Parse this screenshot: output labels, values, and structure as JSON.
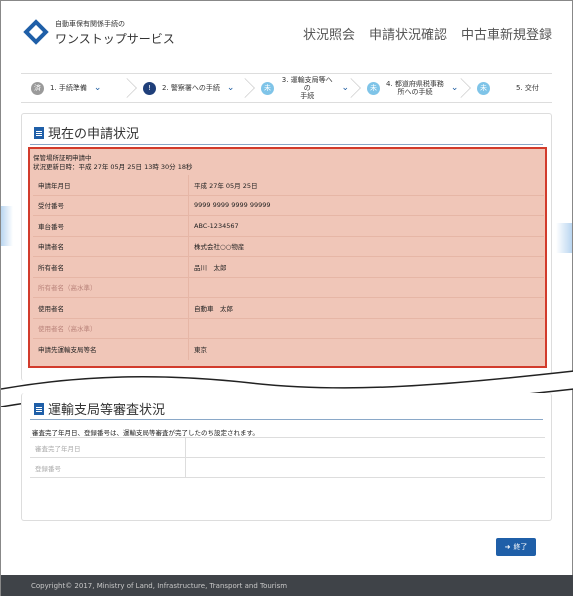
{
  "header": {
    "brand_sub": "自動車保有関係手続の",
    "brand_main": "ワンストップサービス",
    "nav": [
      "状況照会",
      "申請状況確認",
      "中古車新規登録"
    ]
  },
  "steps": [
    {
      "label": "1. 手続準備",
      "badge": "済",
      "color": "#9a9a9a"
    },
    {
      "label": "2. 警察署への手続",
      "badge": "!",
      "color": "#1f3f7a"
    },
    {
      "label": "3. 運輸支局等への\n手続",
      "badge": "未",
      "color": "#7fc4e8"
    },
    {
      "label": "4. 都道府県税事務\n所への手続",
      "badge": "未",
      "color": "#7fc4e8"
    },
    {
      "label": "5. 交付",
      "badge": "未",
      "color": "#7fc4e8"
    }
  ],
  "status_panel": {
    "title": "現在の申請状況",
    "head_line1": "保管場所証明申請中",
    "head_line2": "状況更新日時：平成 27年 05月 25日 13時 30分 18秒",
    "rows": [
      {
        "k": "申請年月日",
        "v": "平成 27年 05月 25日"
      },
      {
        "k": "受付番号",
        "v": "9999 9999 9999 99999"
      },
      {
        "k": "車台番号",
        "v": "ABC-1234567"
      },
      {
        "k": "申請者名",
        "v": "株式会社○○物産"
      },
      {
        "k": "所有者名",
        "v": "品川　太郎"
      },
      {
        "k": "所有者名（高水準）",
        "v": ""
      },
      {
        "k": "使用者名",
        "v": "自動車　太郎"
      },
      {
        "k": "使用者名（高水準）",
        "v": ""
      },
      {
        "k": "申請先運輸支局等名",
        "v": "東京"
      }
    ]
  },
  "review_panel": {
    "title": "運輸支局等審査状況",
    "note": "審査完了年月日、登録番号は、運輸支局等審査が完了したのち設定されます。",
    "rows": [
      {
        "k": "審査完了年月日",
        "v": ""
      },
      {
        "k": "登録番号",
        "v": ""
      }
    ]
  },
  "end_button": "終了",
  "footer": "Copyright© 2017, Ministry of Land, Infrastructure, Transport and Tourism",
  "colors": {
    "accent": "#1f5fa8",
    "highlight_border": "#d23b2c",
    "highlight_bg": "#f0c6b8"
  }
}
